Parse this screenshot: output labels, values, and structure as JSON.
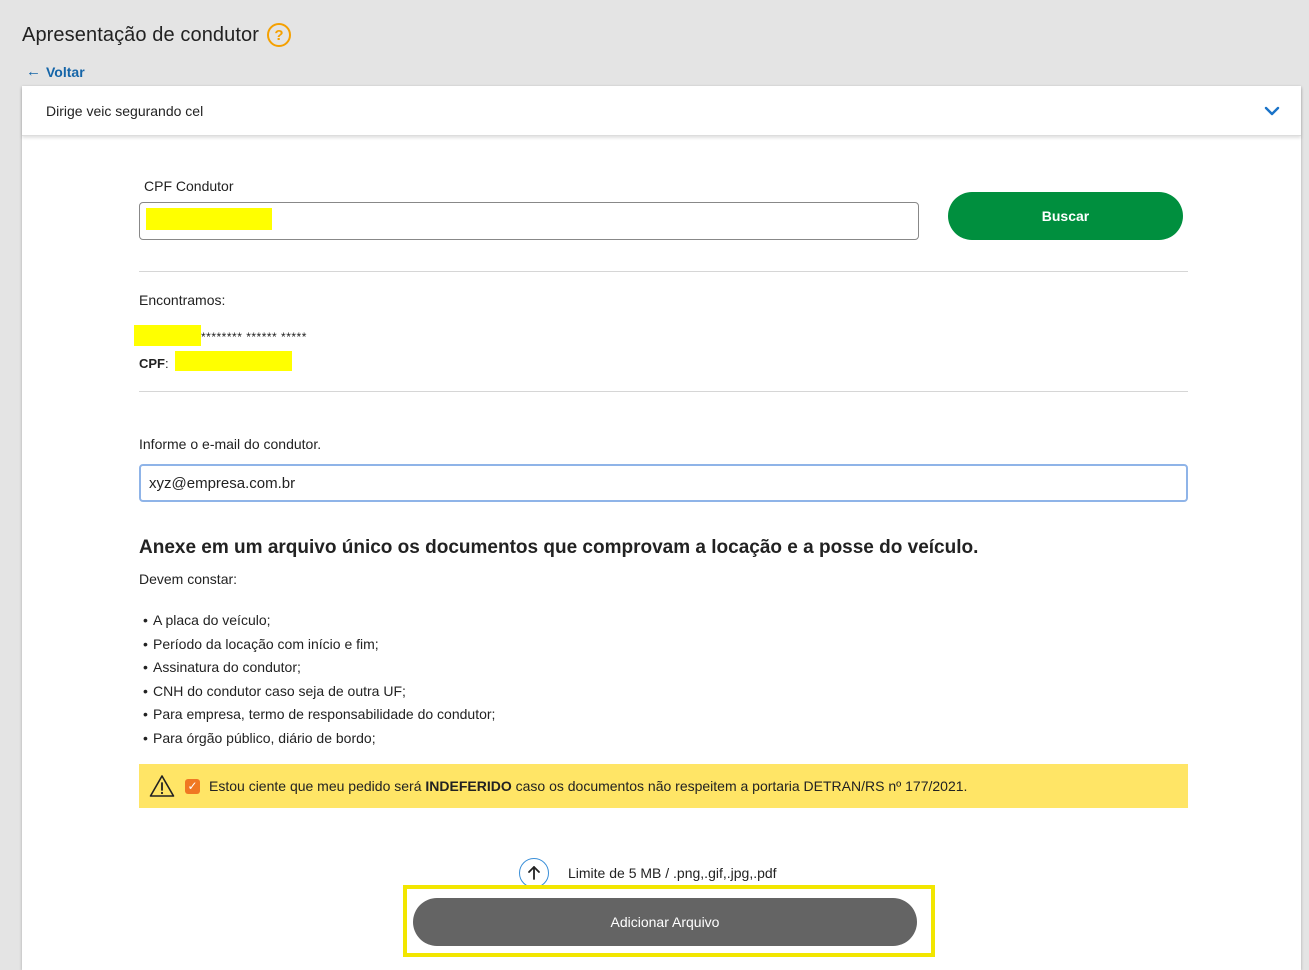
{
  "header": {
    "title": "Apresentação de condutor",
    "help_icon": "question-mark-icon",
    "help_glyph": "?",
    "accent_color": "#f5a000"
  },
  "back_link": {
    "arrow": "←",
    "label": "Voltar"
  },
  "accordion": {
    "title": "Dirige veic segurando cel",
    "icon": "chevron-down-icon"
  },
  "search": {
    "label": "CPF Condutor",
    "button_label": "Buscar",
    "button_color": "#008f3e"
  },
  "result": {
    "found_label": "Encontramos:",
    "masked_name": "******** ****** *****",
    "cpf_label": "CPF",
    "cpf_separator": ":"
  },
  "email": {
    "label": "Informe o e-mail do condutor.",
    "value": "xyz@empresa.com.br"
  },
  "attachment": {
    "heading": "Anexe em um arquivo único os documentos que comprovam a locação e a posse do veículo.",
    "subheading": "Devem constar:",
    "requirements": [
      "A placa do veículo;",
      "Período da locação com início e fim;",
      "Assinatura do condutor;",
      "CNH do condutor caso seja de outra UF;",
      "Para empresa, termo de responsabilidade do condutor;",
      "Para órgão público, diário de bordo;"
    ]
  },
  "warning": {
    "icon": "warning-triangle-icon",
    "checkbox_checked": true,
    "checkbox_glyph": "✓",
    "text_before": "Estou ciente que meu pedido será ",
    "text_bold": "INDEFERIDO",
    "text_after": " caso os documentos não respeitem a portaria DETRAN/RS nº 177/2021.",
    "background_color": "#ffe566"
  },
  "upload": {
    "icon": "upload-arrow-icon",
    "limit_text": "Limite de 5 MB / .png,.gif,.jpg,.pdf",
    "button_label": "Adicionar Arquivo",
    "highlight_color": "#f2e600"
  }
}
